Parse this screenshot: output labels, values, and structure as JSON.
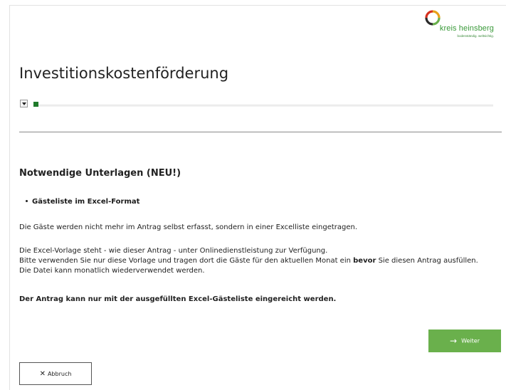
{
  "logo": {
    "name": "kreis heinsberg",
    "tagline": "bodenständig. weltsichtig."
  },
  "page": {
    "title": "Investitionskostenförderung"
  },
  "progress": {
    "toggle_icon": "chevron-down-icon",
    "value": 0.01,
    "fill_color": "#1f7a2a"
  },
  "section": {
    "title": "Notwendige Unterlagen (NEU!)",
    "bullet": "Gästeliste im Excel-Format",
    "paragraph1": "Die Gäste werden nicht mehr im Antrag selbst erfasst, sondern in einer Excelliste eingetragen.",
    "paragraph2": "Die Excel-Vorlage steht - wie dieser Antrag - unter Onlinedienstleistung zur Verfügung.",
    "paragraph3_pre": "Bitte verwenden Sie nur diese Vorlage und tragen dort die Gäste für den aktuellen Monat ein ",
    "paragraph3_bold": "bevor",
    "paragraph3_post": " Sie diesen Antrag ausfüllen.",
    "paragraph4": "Die Datei kann monatlich wiederverwendet werden.",
    "paragraph5": "Der Antrag kann nur mit der ausgefüllten Excel-Gästeliste eingereicht werden."
  },
  "buttons": {
    "next_label": "Weiter",
    "next_icon": "arrow-right-icon",
    "next_color": "#6ab04c",
    "cancel_label": "Abbruch",
    "cancel_icon": "close-icon"
  }
}
